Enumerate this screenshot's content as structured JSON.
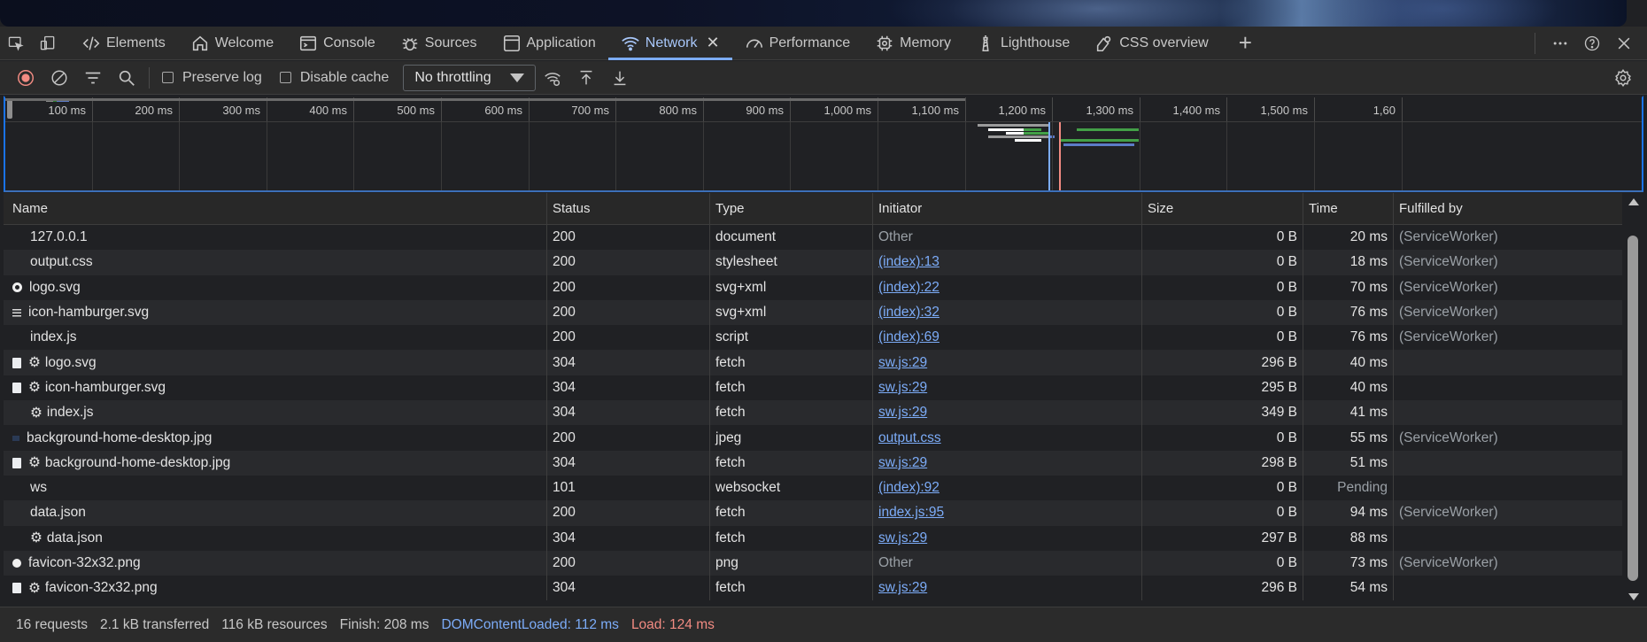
{
  "tabs": [
    {
      "label": "Elements",
      "icon": "code-icon",
      "active": false
    },
    {
      "label": "Welcome",
      "icon": "home-icon",
      "active": false
    },
    {
      "label": "Console",
      "icon": "console-icon",
      "active": false
    },
    {
      "label": "Sources",
      "icon": "bug-icon",
      "active": false
    },
    {
      "label": "Application",
      "icon": "application-icon",
      "active": false
    },
    {
      "label": "Network",
      "icon": "wifi-icon",
      "active": true
    },
    {
      "label": "Performance",
      "icon": "gauge-icon",
      "active": false
    },
    {
      "label": "Memory",
      "icon": "chip-icon",
      "active": false
    },
    {
      "label": "Lighthouse",
      "icon": "lighthouse-icon",
      "active": false
    },
    {
      "label": "CSS overview",
      "icon": "palette-icon",
      "active": false
    }
  ],
  "toolbar": {
    "preserve_log_label": "Preserve log",
    "disable_cache_label": "Disable cache",
    "throttling_value": "No throttling"
  },
  "overview": {
    "ticks": [
      "100 ms",
      "200 ms",
      "300 ms",
      "400 ms",
      "500 ms",
      "600 ms",
      "700 ms",
      "800 ms",
      "900 ms",
      "1,000 ms",
      "1,100 ms",
      "1,200 ms",
      "1,300 ms",
      "1,400 ms",
      "1,500 ms",
      "1,60"
    ]
  },
  "columns": {
    "name": "Name",
    "status": "Status",
    "type": "Type",
    "initiator": "Initiator",
    "size": "Size",
    "time": "Time",
    "fulfilled": "Fulfilled by"
  },
  "rows": [
    {
      "icon": "blank",
      "gear": false,
      "name": "127.0.0.1",
      "status": "200",
      "type": "document",
      "initiator": "Other",
      "init_link": false,
      "size": "0 B",
      "time": "20 ms",
      "fulfilled": "(ServiceWorker)"
    },
    {
      "icon": "blank",
      "gear": false,
      "name": "output.css",
      "status": "200",
      "type": "stylesheet",
      "initiator": "(index):13",
      "init_link": true,
      "size": "0 B",
      "time": "18 ms",
      "fulfilled": "(ServiceWorker)"
    },
    {
      "icon": "circle",
      "gear": false,
      "name": "logo.svg",
      "status": "200",
      "type": "svg+xml",
      "initiator": "(index):22",
      "init_link": true,
      "size": "0 B",
      "time": "70 ms",
      "fulfilled": "(ServiceWorker)"
    },
    {
      "icon": "lines",
      "gear": false,
      "name": "icon-hamburger.svg",
      "status": "200",
      "type": "svg+xml",
      "initiator": "(index):32",
      "init_link": true,
      "size": "0 B",
      "time": "76 ms",
      "fulfilled": "(ServiceWorker)"
    },
    {
      "icon": "blank",
      "gear": false,
      "name": "index.js",
      "status": "200",
      "type": "script",
      "initiator": "(index):69",
      "init_link": true,
      "size": "0 B",
      "time": "76 ms",
      "fulfilled": "(ServiceWorker)"
    },
    {
      "icon": "doc",
      "gear": true,
      "name": "logo.svg",
      "status": "304",
      "type": "fetch",
      "initiator": "sw.js:29",
      "init_link": true,
      "size": "296 B",
      "time": "40 ms",
      "fulfilled": ""
    },
    {
      "icon": "doc",
      "gear": true,
      "name": "icon-hamburger.svg",
      "status": "304",
      "type": "fetch",
      "initiator": "sw.js:29",
      "init_link": true,
      "size": "295 B",
      "time": "40 ms",
      "fulfilled": ""
    },
    {
      "icon": "blank",
      "gear": true,
      "name": "index.js",
      "status": "304",
      "type": "fetch",
      "initiator": "sw.js:29",
      "init_link": true,
      "size": "349 B",
      "time": "41 ms",
      "fulfilled": ""
    },
    {
      "icon": "img",
      "gear": false,
      "name": "background-home-desktop.jpg",
      "status": "200",
      "type": "jpeg",
      "initiator": "output.css",
      "init_link": true,
      "size": "0 B",
      "time": "55 ms",
      "fulfilled": "(ServiceWorker)"
    },
    {
      "icon": "doc",
      "gear": true,
      "name": "background-home-desktop.jpg",
      "status": "304",
      "type": "fetch",
      "initiator": "sw.js:29",
      "init_link": true,
      "size": "298 B",
      "time": "51 ms",
      "fulfilled": ""
    },
    {
      "icon": "blank",
      "gear": false,
      "name": "ws",
      "status": "101",
      "type": "websocket",
      "initiator": "(index):92",
      "init_link": true,
      "size": "0 B",
      "time": "Pending",
      "time_muted": true,
      "fulfilled": ""
    },
    {
      "icon": "blank",
      "gear": false,
      "name": "data.json",
      "status": "200",
      "type": "fetch",
      "initiator": "index.js:95",
      "init_link": true,
      "size": "0 B",
      "time": "94 ms",
      "fulfilled": "(ServiceWorker)"
    },
    {
      "icon": "blank",
      "gear": true,
      "name": "data.json",
      "status": "304",
      "type": "fetch",
      "initiator": "sw.js:29",
      "init_link": true,
      "size": "297 B",
      "time": "88 ms",
      "fulfilled": ""
    },
    {
      "icon": "dot",
      "gear": false,
      "name": "favicon-32x32.png",
      "status": "200",
      "type": "png",
      "initiator": "Other",
      "init_link": false,
      "size": "0 B",
      "time": "73 ms",
      "fulfilled": "(ServiceWorker)"
    },
    {
      "icon": "doc",
      "gear": true,
      "name": "favicon-32x32.png",
      "status": "304",
      "type": "fetch",
      "initiator": "sw.js:29",
      "init_link": true,
      "size": "296 B",
      "time": "54 ms",
      "fulfilled": ""
    }
  ],
  "status": {
    "requests": "16 requests",
    "transferred": "2.1 kB transferred",
    "resources": "116 kB resources",
    "finish": "Finish: 208 ms",
    "dom_content_loaded": "DOMContentLoaded: 112 ms",
    "load": "Load: 124 ms"
  },
  "colors": {
    "accent": "#7cacf8",
    "load": "#f28b82"
  }
}
